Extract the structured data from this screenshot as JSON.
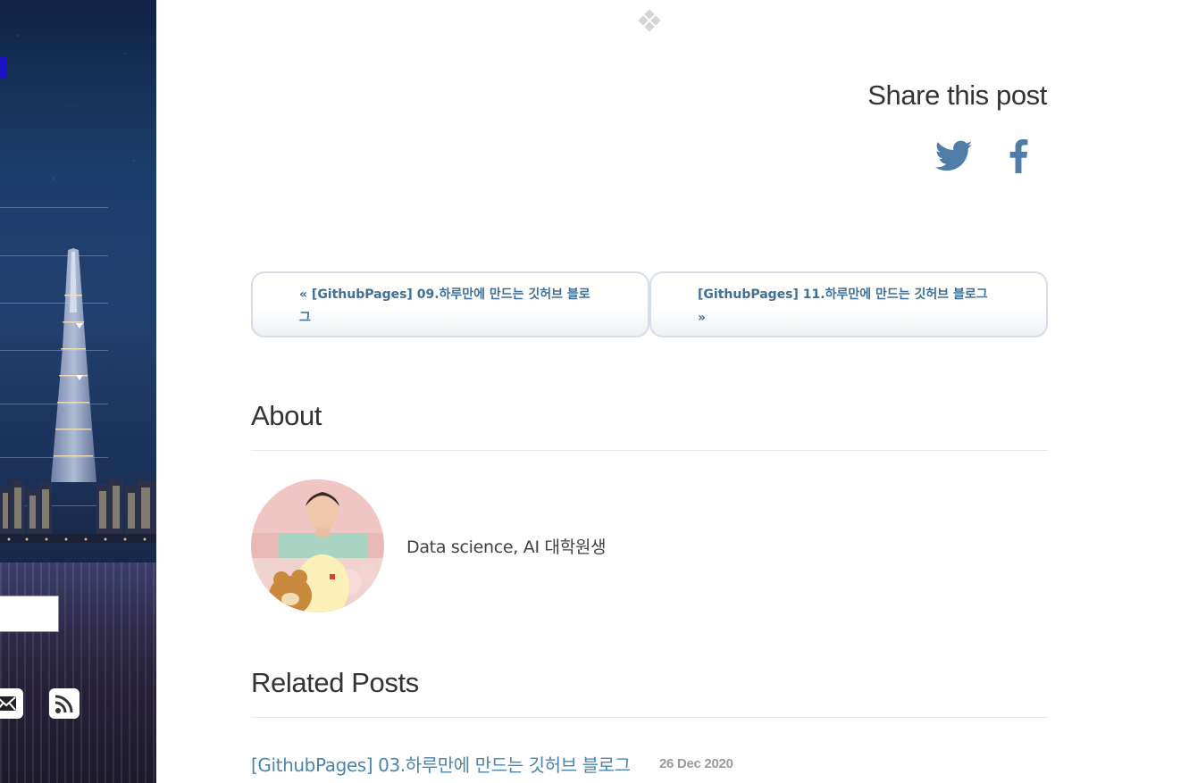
{
  "share": {
    "title": "Share this post",
    "twitter_icon": "twitter-icon",
    "facebook_icon": "facebook-icon",
    "brand_color": "#4e7ea8"
  },
  "pager": {
    "previous": {
      "line1": "« [GithubPages] 09.하루만에 만드는 깃허브 블로",
      "line2": "그"
    },
    "next": {
      "line1": "[GithubPages] 11.하루만에 만드는 깃허브 블로그",
      "line2": "»"
    }
  },
  "about": {
    "title": "About",
    "description": "Data science, AI 대학원생",
    "avatar_icon": "profile-photo"
  },
  "related": {
    "title": "Related Posts",
    "posts": [
      {
        "title": "[GithubPages] 03.하루만에 만드는 깃허브 블로그",
        "date": "26 Dec 2020"
      }
    ]
  },
  "sidebar": {
    "icons": [
      "mail-icon",
      "rss-icon"
    ],
    "search_placeholder": ""
  },
  "colors": {
    "link": "#4b84ae",
    "heading": "#333333",
    "pager_border": "#d6dde6"
  }
}
